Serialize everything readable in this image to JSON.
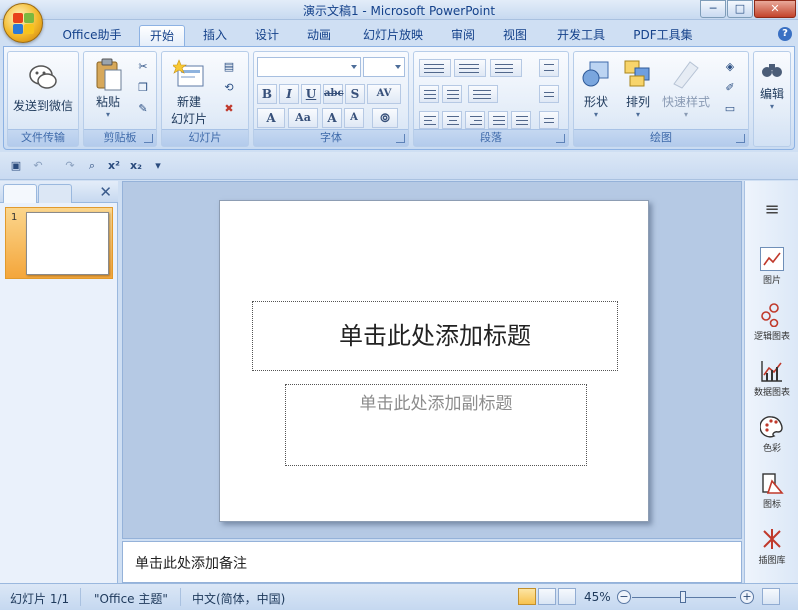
{
  "window": {
    "title": "演示文稿1 - Microsoft PowerPoint",
    "minimize": "─",
    "maximize": "□",
    "close": "✕"
  },
  "tabs": [
    {
      "label": "Office助手"
    },
    {
      "label": "开始"
    },
    {
      "label": "插入"
    },
    {
      "label": "设计"
    },
    {
      "label": "动画"
    },
    {
      "label": "幻灯片放映"
    },
    {
      "label": "审阅"
    },
    {
      "label": "视图"
    },
    {
      "label": "开发工具"
    },
    {
      "label": "PDF工具集"
    }
  ],
  "active_tab": "开始",
  "ribbon": {
    "groups": {
      "file_transfer": "文件传输",
      "clipboard": "剪贴板",
      "slides": "幻灯片",
      "font": "字体",
      "paragraph": "段落",
      "drawing": "绘图",
      "editing": ""
    },
    "buttons": {
      "send_wechat": "发送到微信",
      "paste": "粘贴",
      "new_slide": "新建",
      "new_slide2": "幻灯片",
      "shapes": "形状",
      "arrange": "排列",
      "quick_styles": "快速样式",
      "edit": "编辑"
    },
    "font_buttons": [
      "B",
      "I",
      "U",
      "abc",
      "S",
      "AV"
    ]
  },
  "left_pane": {
    "slide_number": "1",
    "close": "✕"
  },
  "slide": {
    "title_placeholder": "单击此处添加标题",
    "subtitle_placeholder": "单击此处添加副标题"
  },
  "notes": {
    "placeholder": "单击此处添加备注"
  },
  "right_pane": {
    "items": [
      {
        "label": "图片"
      },
      {
        "label": "逻辑图表"
      },
      {
        "label": "数据图表"
      },
      {
        "label": "色彩"
      },
      {
        "label": "图标"
      },
      {
        "label": "插图库"
      }
    ]
  },
  "status": {
    "slide_info": "幻灯片 1/1",
    "theme": "\"Office 主题\"",
    "language": "中文(简体，中国)",
    "zoom": "45%",
    "zoom_minus": "−",
    "zoom_plus": "+"
  },
  "colors": {
    "ribbon_accent": "#15428b",
    "thumb_selected": "#f4a63b",
    "background": "#b5c9e4"
  }
}
